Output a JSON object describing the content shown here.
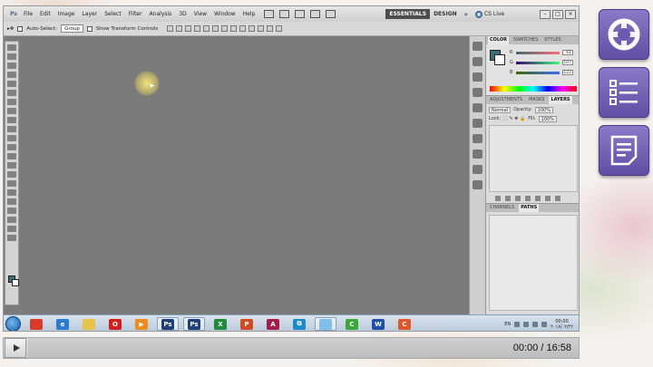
{
  "photoshop": {
    "logo": "Ps",
    "menus": [
      "File",
      "Edit",
      "Image",
      "Layer",
      "Select",
      "Filter",
      "Analysis",
      "3D",
      "View",
      "Window",
      "Help"
    ],
    "workspace": {
      "essentials": "ESSENTIALS",
      "design": "DESIGN",
      "more": "»"
    },
    "cs_live": "CS Live",
    "options_bar": {
      "auto_select_label": "Auto-Select:",
      "auto_select_value": "Group",
      "transform_label": "Show Transform Controls"
    },
    "color_panel": {
      "tabs": [
        "COLOR",
        "SWATCHES",
        "STYLES"
      ],
      "active_tab": "COLOR",
      "channels": [
        {
          "label": "R",
          "value": "61",
          "color": "#d43a3a"
        },
        {
          "label": "G",
          "value": "107",
          "color": "#3aa83a"
        },
        {
          "label": "B",
          "value": "122",
          "color": "#3a5ad4"
        }
      ],
      "foreground": "#3b6e74",
      "background": "#ffffff"
    },
    "layers_panel": {
      "tabs": [
        "ADJUSTMENTS",
        "MASKS",
        "LAYERS"
      ],
      "active_tab": "LAYERS",
      "blend_mode": "Normal",
      "opacity_label": "Opacity:",
      "opacity_value": "100%",
      "lock_label": "Lock:",
      "fill_label": "Fill:",
      "fill_value": "100%"
    },
    "paths_panel": {
      "tabs": [
        "CHANNELS",
        "PATHS"
      ],
      "active_tab": "PATHS"
    }
  },
  "taskbar": {
    "apps": [
      {
        "name": "chrome",
        "label": "",
        "color": "#d93b2b"
      },
      {
        "name": "ie",
        "label": "e",
        "color": "#2a7bd1"
      },
      {
        "name": "explorer",
        "label": "",
        "color": "#e8c24a"
      },
      {
        "name": "opera",
        "label": "O",
        "color": "#d21d1d"
      },
      {
        "name": "media",
        "label": "▶",
        "color": "#f08a1c"
      },
      {
        "name": "photoshop-1",
        "label": "Ps",
        "color": "#1f3f7a"
      },
      {
        "name": "photoshop-2",
        "label": "Ps",
        "color": "#1f3f7a"
      },
      {
        "name": "excel",
        "label": "X",
        "color": "#1f8a3a"
      },
      {
        "name": "powerpoint",
        "label": "P",
        "color": "#d24a1f"
      },
      {
        "name": "access",
        "label": "A",
        "color": "#a31d4a"
      },
      {
        "name": "remote",
        "label": "⧉",
        "color": "#1b8ac9"
      },
      {
        "name": "folder",
        "label": "",
        "color": "#7fbfe8"
      },
      {
        "name": "camtasia",
        "label": "C",
        "color": "#3aa83a"
      },
      {
        "name": "word",
        "label": "W",
        "color": "#1f4fa8"
      },
      {
        "name": "camtasia-2",
        "label": "C",
        "color": "#e0552a"
      }
    ],
    "tray": {
      "lang": "EN",
      "time": "00:00",
      "date": "۲۰۱۸/۰۲/۲۲"
    }
  },
  "player": {
    "time": "00:00 / 16:58",
    "progress": 0
  },
  "side_nav": [
    {
      "name": "home-nav",
      "icon": "lifebuoy-icon"
    },
    {
      "name": "contents-nav",
      "icon": "list-icon"
    },
    {
      "name": "notes-nav",
      "icon": "document-icon"
    }
  ]
}
